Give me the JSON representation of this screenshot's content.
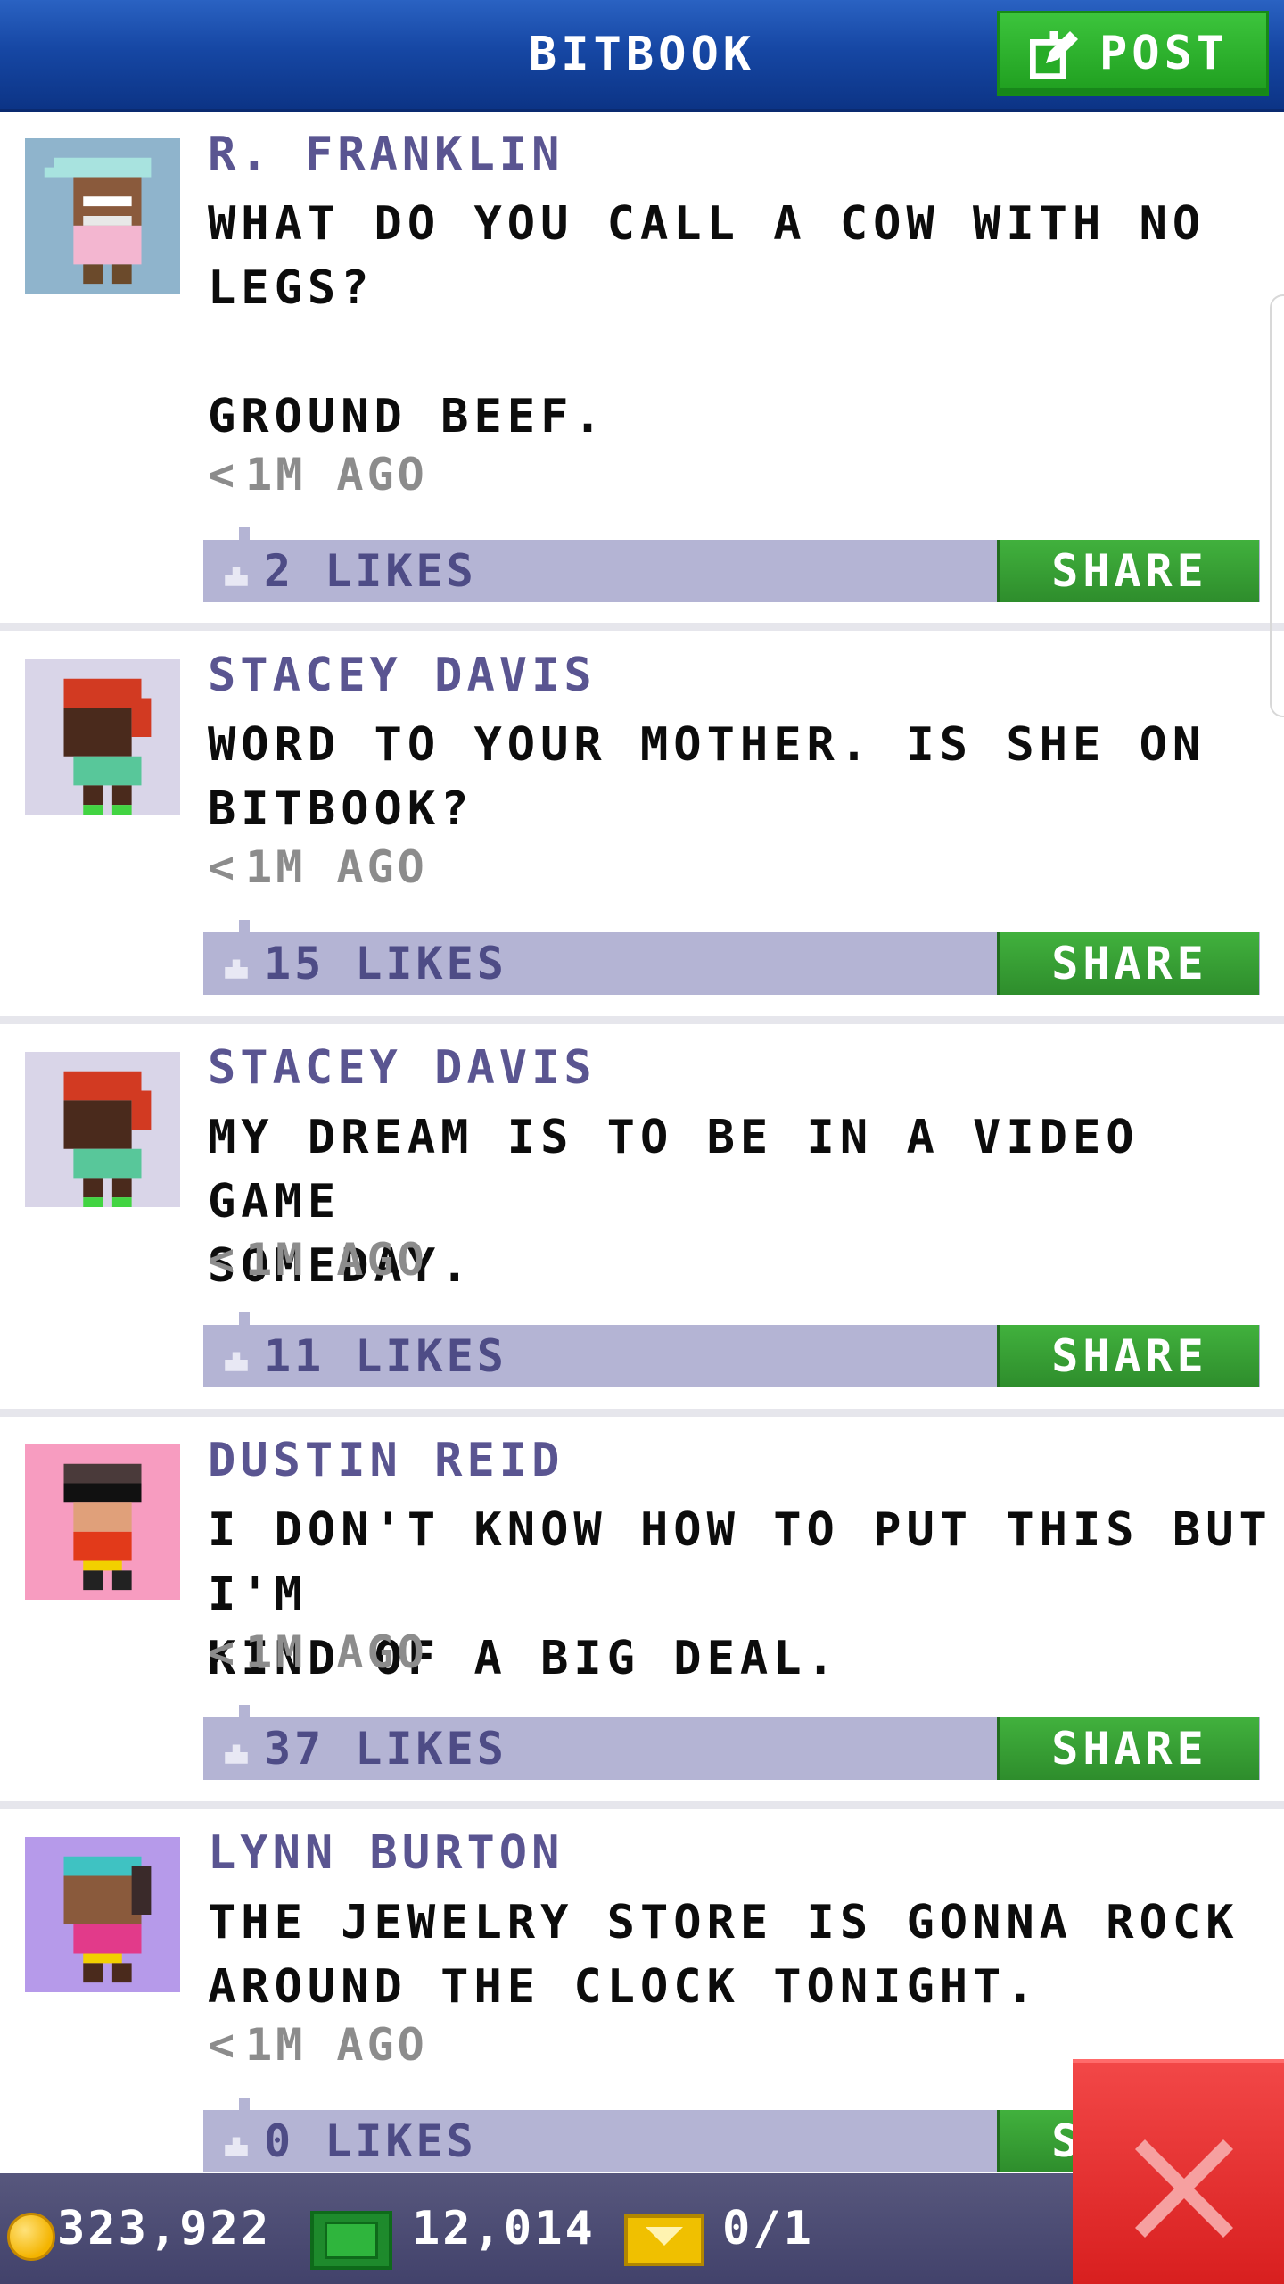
{
  "header": {
    "title": "BITBOOK",
    "post_label": "POST"
  },
  "posts": [
    {
      "author": "R. FRANKLIN",
      "text": "WHAT DO YOU CALL A COW WITH NO\nLEGS?\n\nGROUND BEEF.",
      "time": "1M AGO",
      "likes": "2 LIKES",
      "share": "SHARE",
      "avatar_bg": "#8fb4cc"
    },
    {
      "author": "STACEY DAVIS",
      "text": "WORD TO YOUR MOTHER. IS SHE ON\nBITBOOK?",
      "time": "1M AGO",
      "likes": "15 LIKES",
      "share": "SHARE",
      "avatar_bg": "#d9d5e8"
    },
    {
      "author": "STACEY DAVIS",
      "text": "MY DREAM IS TO BE IN A VIDEO GAME\nSOMEDAY.",
      "time": "1M AGO",
      "likes": "11 LIKES",
      "share": "SHARE",
      "avatar_bg": "#d9d5e8"
    },
    {
      "author": "DUSTIN REID",
      "text": "I DON'T KNOW HOW TO PUT THIS BUT I'M\nKIND OF A BIG DEAL.",
      "time": "1M AGO",
      "likes": "37 LIKES",
      "share": "SHARE",
      "avatar_bg": "#f79cc0"
    },
    {
      "author": "LYNN BURTON",
      "text": "THE JEWELRY STORE IS GONNA ROCK\nAROUND THE CLOCK TONIGHT.",
      "time": "1M AGO",
      "likes": "0 LIKES",
      "share": "SHARE",
      "avatar_bg": "#b69aea"
    }
  ],
  "time_prefix": "<",
  "status_bar": {
    "coins": "323,922",
    "bux": "12,014",
    "tickets": "0/1"
  },
  "colors": {
    "header_blue": "#1647a4",
    "post_green": "#2fa82f",
    "likes_bar": "#b4b4d4",
    "close_red": "#e02a2a"
  }
}
